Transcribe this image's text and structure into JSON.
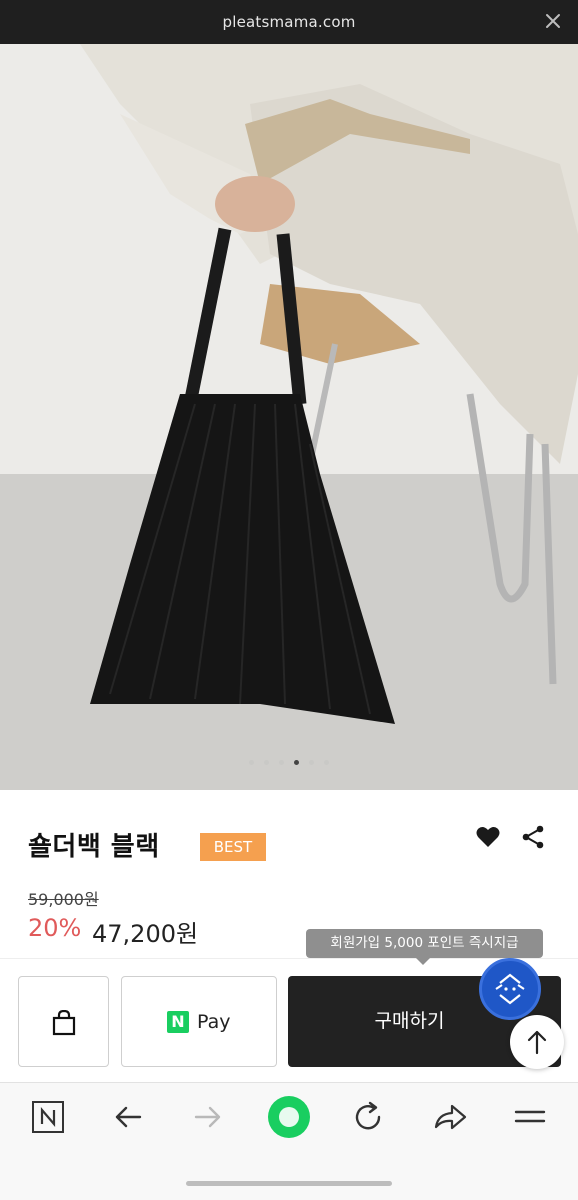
{
  "browser": {
    "url": "pleatsmama.com",
    "close_icon": "close-icon"
  },
  "gallery": {
    "slide_count": 6,
    "active_index": 3
  },
  "product": {
    "title": "숄더백 블랙",
    "badge": "BEST",
    "original_price": "59,000원",
    "discount": "20%",
    "price": "47,200원",
    "badge_color": "#f5a04f",
    "discount_color": "#e05a5a"
  },
  "tooltip": {
    "text": "회원가입 5,000 포인트 즉시지급"
  },
  "actions": {
    "npay_logo": "N",
    "npay_label": "Pay",
    "buy_label": "구매하기"
  },
  "nav": {
    "icons": [
      "naver-icon",
      "back-arrow-icon",
      "forward-arrow-icon",
      "green-dot-icon",
      "reload-icon",
      "share-arrow-icon",
      "menu-icon"
    ]
  }
}
